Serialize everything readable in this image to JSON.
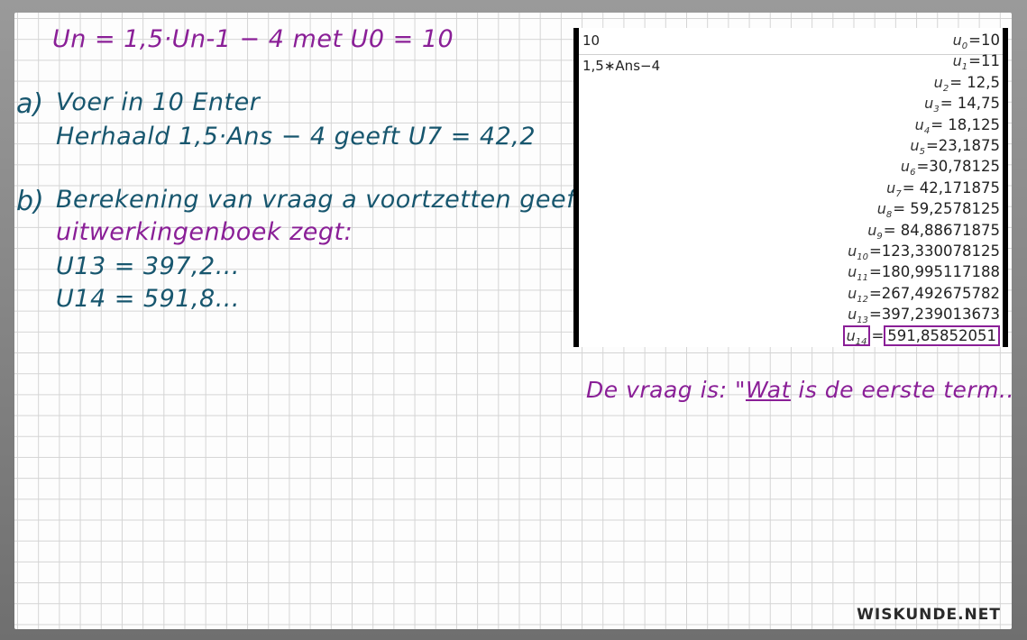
{
  "notes": {
    "formula": "Un = 1,5·Un-1 − 4   met  U0 = 10",
    "part_a_label": "a)",
    "part_a_line1": "Voer in 10 Enter",
    "part_a_line2": "Herhaald 1,5·Ans − 4 geeft  U7 = 42,2",
    "part_b_label": "b)",
    "part_b_line1": "Berekening van vraag a voortzetten geeft",
    "part_b_line2": "uitwerkingenboek zegt:",
    "part_b_line3": "U13 = 397,2...",
    "part_b_line4": "U14 = 591,8...",
    "question_prefix": "De vraag is: \"",
    "question_underlined": "Wat",
    "question_suffix": " is de eerste term...\""
  },
  "calculator": {
    "input1": "10",
    "input2": "1,5∗Ans−4",
    "results": [
      {
        "label": "U0",
        "value": "=10"
      },
      {
        "label": "U1",
        "value": "=11"
      },
      {
        "label": "U2",
        "value": "= 12,5"
      },
      {
        "label": "U3",
        "value": "= 14,75"
      },
      {
        "label": "U4",
        "value": "= 18,125"
      },
      {
        "label": "U5",
        "value": "=23,1875"
      },
      {
        "label": "U6",
        "value": "=30,78125"
      },
      {
        "label": "U7",
        "value": "= 42,171875"
      },
      {
        "label": "U8",
        "value": "= 59,2578125"
      },
      {
        "label": "U9",
        "value": "= 84,88671875"
      },
      {
        "label": "U10",
        "value": "=123,330078125"
      },
      {
        "label": "U11",
        "value": "=180,995117188"
      },
      {
        "label": "U12",
        "value": "=267,492675782"
      },
      {
        "label": "U13",
        "value": "=397,239013673"
      },
      {
        "label": "U14",
        "value": "591,85852051"
      }
    ]
  },
  "watermark": "WISKUNDE.NET",
  "colors": {
    "purple": "#8a1f97",
    "teal": "#17566e"
  }
}
